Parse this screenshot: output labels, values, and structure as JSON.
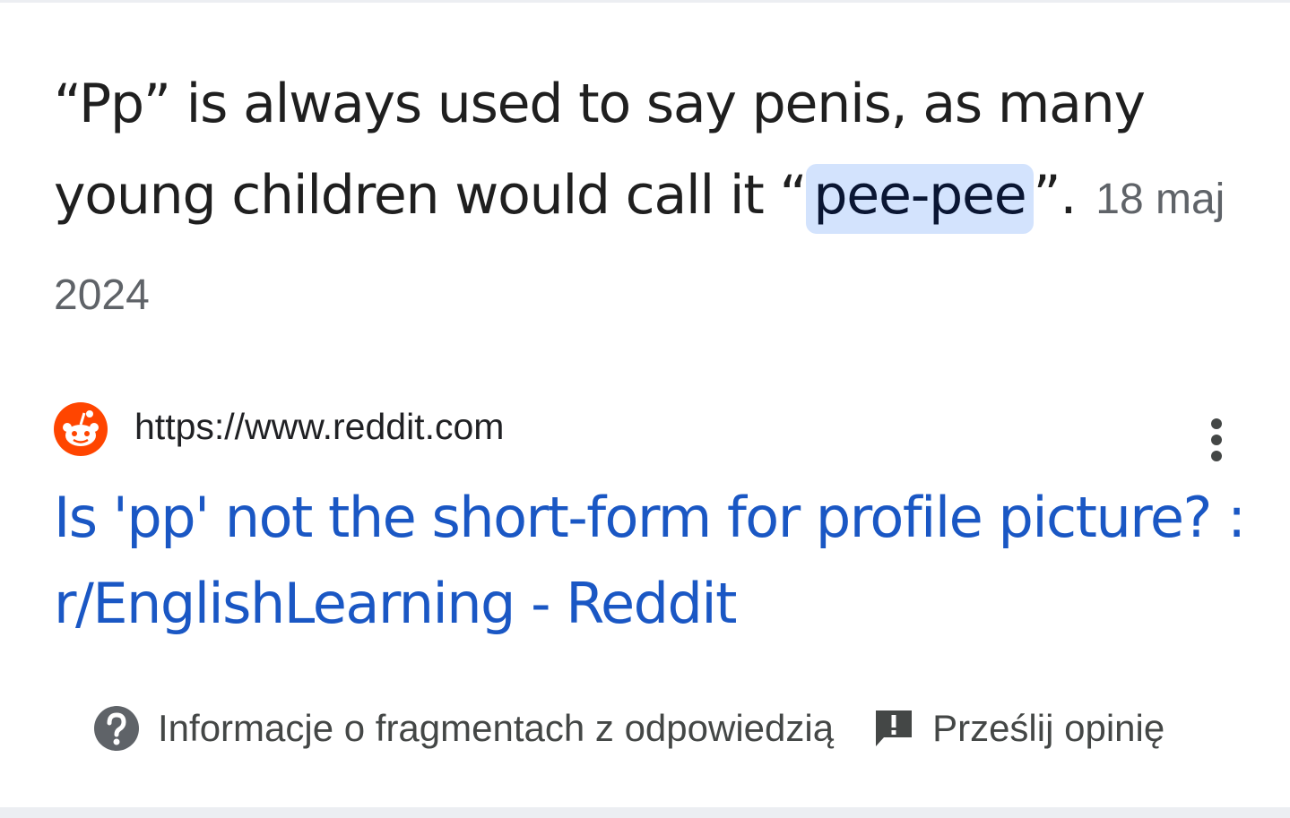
{
  "snippet": {
    "before_highlight": "“Pp” is always used to say penis, as many young children would call it “",
    "highlight": "pee-pee",
    "after_highlight": "”.",
    "date": "18 maj 2024"
  },
  "source": {
    "favicon_icon": "reddit-logo-icon",
    "url": "https://www.reddit.com",
    "more_icon": "more-vert-icon"
  },
  "result": {
    "title": "Is 'pp' not the short-form for profile picture? : r/EnglishLearning - Reddit"
  },
  "footer": {
    "about_icon": "help-circle-icon",
    "about_label": "Informacje o fragmentach z odpowiedzią",
    "feedback_icon": "feedback-icon",
    "feedback_label": "Prześlij opinię"
  },
  "colors": {
    "link": "#1a57c4",
    "highlight_bg": "#d3e3fd",
    "date_text": "#5f6368",
    "reddit_orange": "#ff4500"
  }
}
